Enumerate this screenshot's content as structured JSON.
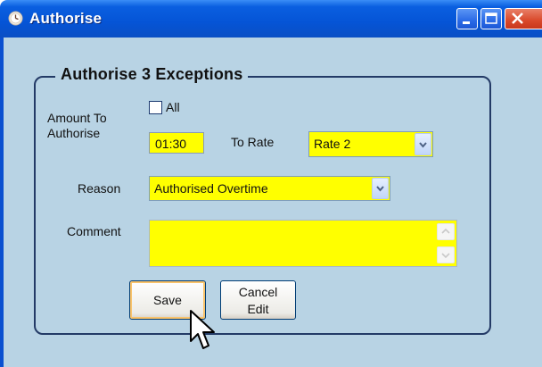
{
  "window": {
    "title": "Authorise",
    "icon": "clock-icon",
    "controls": [
      "minimize-icon",
      "maximize-icon",
      "close-icon"
    ]
  },
  "group": {
    "title": "Authorise 3 Exceptions"
  },
  "form": {
    "amount_label_line1": "Amount To",
    "amount_label_line2": "Authorise",
    "all_checkbox_label": "All",
    "all_checked": false,
    "amount_value": "01:30",
    "to_rate_label": "To Rate",
    "rate_value": "Rate 2",
    "reason_label": "Reason",
    "reason_value": "Authorised Overtime",
    "comment_label": "Comment",
    "comment_value": ""
  },
  "buttons": {
    "save_label": "Save",
    "cancel_line1": "Cancel",
    "cancel_line2": "Edit"
  },
  "colors": {
    "panel_bg": "#b8d3e4",
    "titlebar": "#0554d6",
    "input_highlight": "#ffff00",
    "close_button": "#d9482a"
  }
}
